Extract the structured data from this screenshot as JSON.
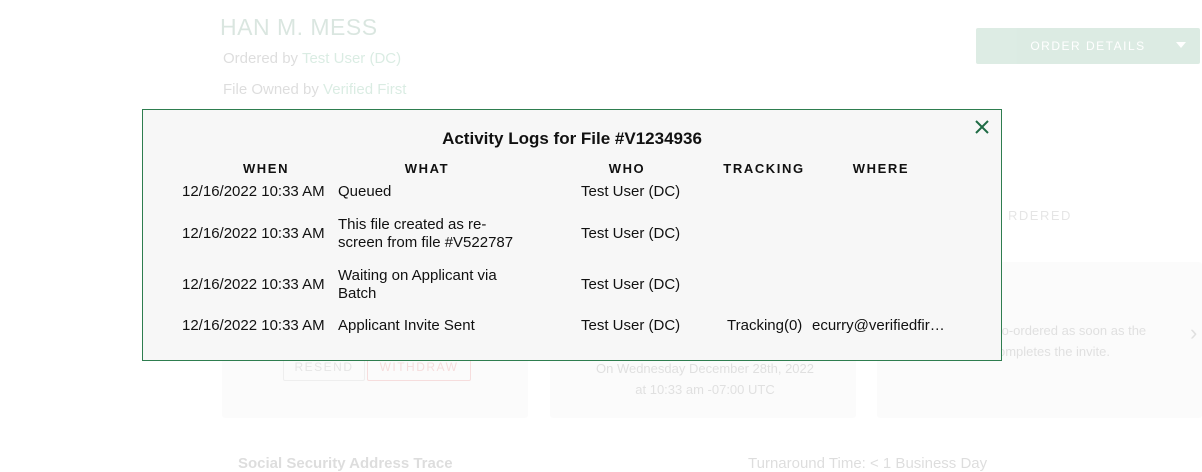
{
  "background": {
    "applicant_name": "HAN M. MESS",
    "ordered_by_label": "Ordered by",
    "ordered_by_value": "Test User (DC)",
    "file_owned_label": "File Owned by",
    "file_owned_value": "Verified First",
    "order_details_label": "ORDER DETAILS",
    "ordered_label": "RDERED",
    "resend_label": "RESEND",
    "withdraw_label": "WITHDRAW",
    "card2_line1": "On Wednesday December 28th, 2022",
    "card2_line2": "at 10:33 am -07:00 UTC",
    "card3_line1": "to-ordered as soon as the",
    "card3_line2": "ompletes the invite.",
    "bottom_left": "Social Security Address Trace",
    "bottom_right": "Turnaround Time: < 1 Business Day"
  },
  "modal": {
    "title": "Activity Logs for File #V1234936",
    "columns": {
      "when": "WHEN",
      "what": "WHAT",
      "who": "WHO",
      "tracking": "TRACKING",
      "where": "WHERE"
    },
    "rows": [
      {
        "when": "12/16/2022 10:33 AM",
        "what_line1": "Queued",
        "what_line2": "",
        "who": "Test User (DC)",
        "tracking": "",
        "where": ""
      },
      {
        "when": "12/16/2022 10:33 AM",
        "what_line1": "This file created as re-",
        "what_line2": "screen from file #V522787",
        "who": "Test User (DC)",
        "tracking": "",
        "where": ""
      },
      {
        "when": "12/16/2022 10:33 AM",
        "what_line1": "Waiting on Applicant via",
        "what_line2": "Batch",
        "who": "Test User (DC)",
        "tracking": "",
        "where": ""
      },
      {
        "when": "12/16/2022 10:33 AM",
        "what_line1": "Applicant Invite Sent",
        "what_line2": "",
        "who": "Test User (DC)",
        "tracking": "Tracking(0)",
        "where": "ecurry@verifiedfir…"
      }
    ]
  }
}
